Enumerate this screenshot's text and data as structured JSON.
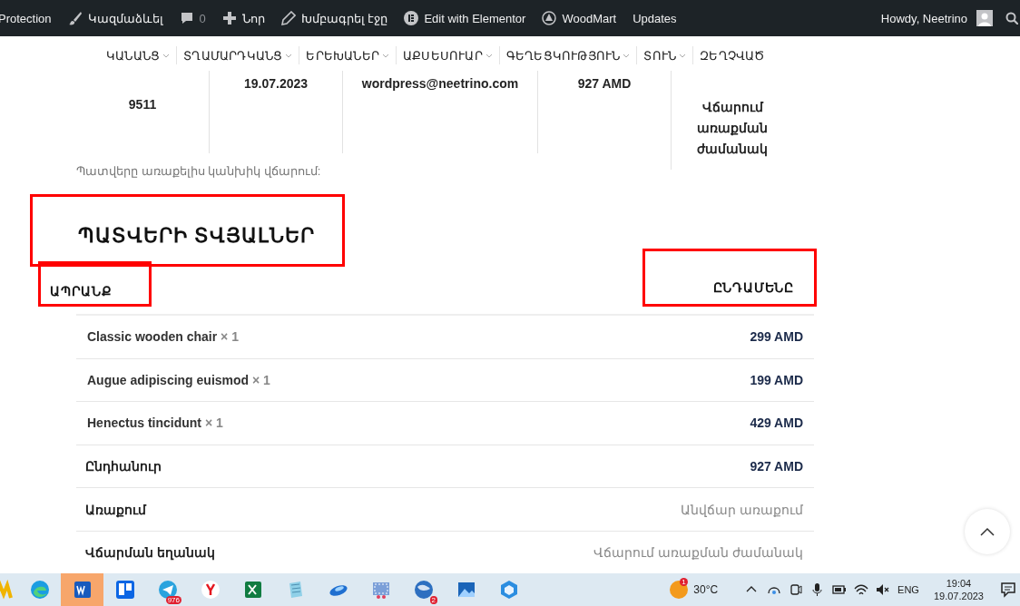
{
  "admin_bar": {
    "items": [
      {
        "label": "Protection"
      },
      {
        "label": "Կազմաձևել"
      },
      {
        "label": "0"
      },
      {
        "label": "Նոր"
      },
      {
        "label": "Խմբագրել էջը"
      },
      {
        "label": "Edit with Elementor"
      },
      {
        "label": "WoodMart"
      },
      {
        "label": "Updates"
      }
    ],
    "greeting": "Howdy, Neetrino"
  },
  "nav": [
    {
      "label": "ԿԱՆԱՆՑ",
      "has_dropdown": true
    },
    {
      "label": "ՏՂԱՄԱՐԴԿԱՆՑ",
      "has_dropdown": true
    },
    {
      "label": "ԵՐԵԽԱՆԵՐ",
      "has_dropdown": true
    },
    {
      "label": "ԱՔՍԵՍՈՒԱՐ",
      "has_dropdown": true
    },
    {
      "label": "ԳԵՂԵՑԿՈՒԹՅՈՒՆ",
      "has_dropdown": true
    },
    {
      "label": "ՏՈՒՆ",
      "has_dropdown": true
    },
    {
      "label": "ԶԵՂՉՎԱԾ",
      "has_dropdown": false
    }
  ],
  "order_overview": [
    {
      "value": "9511"
    },
    {
      "value": "19.07.2023"
    },
    {
      "value": "wordpress@neetrino.com"
    },
    {
      "value": "927 AMD"
    },
    {
      "value": "Վճարում առաքման ժամանակ"
    }
  ],
  "payment_note": "Պատվերը առաքելիս կանխիկ վճարում:",
  "order_details": {
    "title": "ՊԱՏՎԵՐԻ ՏՎՅԱԼՆԵՐ",
    "title_highlighted": true,
    "columns": [
      {
        "label": "ԱՊՐԱՆՔ",
        "highlighted": true
      },
      {
        "label": "ԸՆԴԱՄԵՆԸ",
        "highlighted": true
      }
    ],
    "items": [
      {
        "name": "Classic wooden chair",
        "quantity": "× 1",
        "total": "299 AMD"
      },
      {
        "name": "Augue adipiscing euismod",
        "quantity": "× 1",
        "total": "199 AMD"
      },
      {
        "name": "Henectus tincidunt",
        "quantity": "× 1",
        "total": "429 AMD"
      }
    ],
    "totals": [
      {
        "label": "Ընդհանուր",
        "value": "927 AMD",
        "kind": "amount"
      },
      {
        "label": "Առաքում",
        "value": "Անվճար առաքում",
        "kind": "note"
      },
      {
        "label": "Վճարման եղանակ",
        "value": "Վճարում առաքման ժամանակ",
        "kind": "note"
      }
    ]
  },
  "taskbar": {
    "apps": [
      {
        "active": false
      },
      {
        "active": false
      },
      {
        "active": true
      },
      {
        "active": false
      },
      {
        "active": false,
        "badge": "976"
      },
      {
        "active": false
      },
      {
        "active": false
      },
      {
        "active": false
      },
      {
        "active": false
      },
      {
        "active": false
      },
      {
        "active": false,
        "badge": "2"
      },
      {
        "active": false
      },
      {
        "active": false
      }
    ],
    "weather": {
      "badge": "1",
      "temperature": "30°C"
    },
    "language": "ENG",
    "time": "19:04",
    "date": "19.07.2023"
  }
}
